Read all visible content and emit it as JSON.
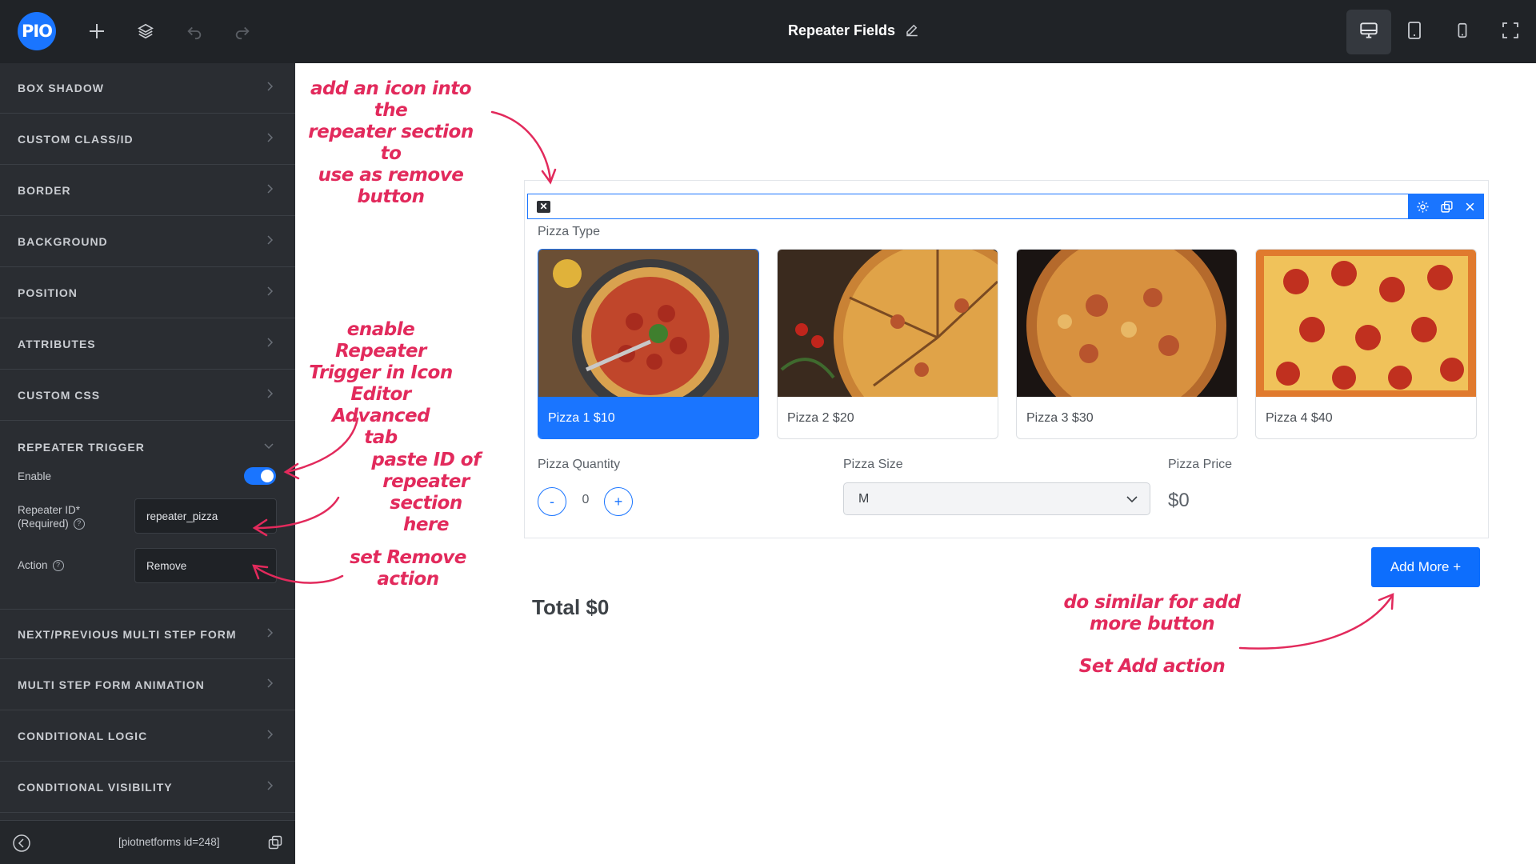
{
  "topbar": {
    "logo": "PIO",
    "title": "Repeater Fields",
    "tools": [
      "add-icon",
      "layers-icon",
      "undo-icon",
      "redo-icon"
    ],
    "devices": [
      "desktop-icon",
      "tablet-icon",
      "mobile-icon",
      "fullscreen-icon"
    ]
  },
  "sidebar": {
    "sections": [
      "BOX SHADOW",
      "CUSTOM CLASS/ID",
      "BORDER",
      "BACKGROUND",
      "POSITION",
      "ATTRIBUTES",
      "CUSTOM CSS",
      "REPEATER TRIGGER",
      "NEXT/PREVIOUS MULTI STEP FORM",
      "MULTI STEP FORM ANIMATION",
      "CONDITIONAL LOGIC",
      "CONDITIONAL VISIBILITY"
    ],
    "repeater": {
      "enable_label": "Enable",
      "enabled": true,
      "id_label_1": "Repeater ID*",
      "id_label_2": "(Required)",
      "id_value": "repeater_pizza",
      "action_label": "Action",
      "action_value": "Remove",
      "help_glyph": "?"
    },
    "shortcode": "[piotnetforms id=248]"
  },
  "form": {
    "remove_glyph": "✕",
    "pizza_type_label": "Pizza Type",
    "pizzas": [
      {
        "label": "Pizza 1 $10",
        "selected": true
      },
      {
        "label": "Pizza 2 $20",
        "selected": false
      },
      {
        "label": "Pizza 3 $30",
        "selected": false
      },
      {
        "label": "Pizza 4 $40",
        "selected": false
      }
    ],
    "quantity_label": "Pizza Quantity",
    "minus": "-",
    "quantity": "0",
    "plus": "+",
    "size_label": "Pizza Size",
    "size_value": "M",
    "price_label": "Pizza Price",
    "price_value": "$0",
    "add_more": "Add More +",
    "total": "Total $0"
  },
  "annotations": {
    "a1": [
      "add an icon into the",
      "repeater section to",
      "use as remove",
      "button"
    ],
    "a2": [
      "enable Repeater",
      "Trigger in Icon",
      "Editor Advanced",
      "tab"
    ],
    "a3": [
      "paste ID of",
      "repeater section",
      "here"
    ],
    "a4": [
      "set Remove",
      "action"
    ],
    "a5": [
      "do similar for add",
      "more button"
    ],
    "a6": [
      "Set Add action"
    ]
  },
  "colors": {
    "accent": "#1a75ff",
    "annotation": "#e22a5c",
    "sidebar": "#2a2d32",
    "topbar": "#202327"
  }
}
